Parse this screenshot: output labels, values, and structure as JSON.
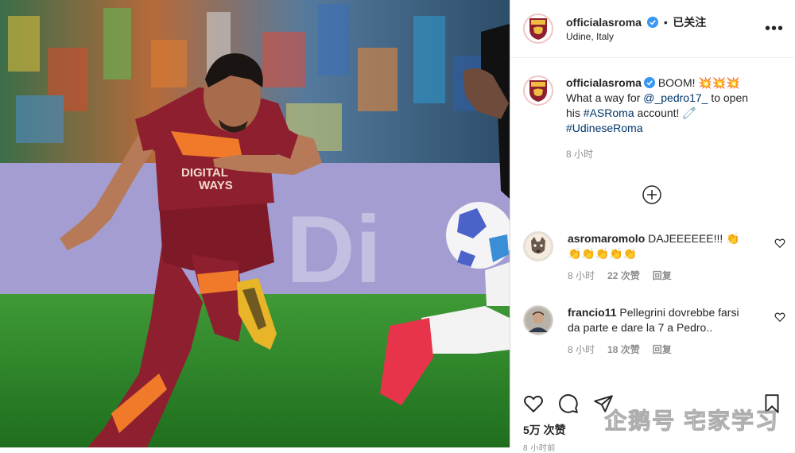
{
  "post": {
    "username": "officialasroma",
    "follow_label": "已关注",
    "location": "Udine, Italy",
    "more_label": "•••"
  },
  "photo": {
    "shirt_sponsor": "DIGITAL",
    "shirt_sponsor2": "WAYS",
    "board_text": "Di"
  },
  "caption": {
    "username": "officialasroma",
    "text_1": " BOOM! 💥💥💥",
    "text_2": "What a way for ",
    "mention": "@_pedro17_",
    "text_3": " to open his ",
    "hashtag1": "#ASRoma",
    "text_4": " account! 🧷",
    "hashtag2": "#UdineseRoma",
    "time": "8 小时"
  },
  "comments": [
    {
      "username": "asromaromolo",
      "text": " DAJEEEEEE!!! 👏",
      "text2": "👏👏👏👏👏",
      "time": "8 小时",
      "likes": "22 次赞",
      "reply": "回复"
    },
    {
      "username": "francio11",
      "text": " Pellegrini dovrebbe farsi da parte e dare la 7 a Pedro..",
      "time": "8 小时",
      "likes": "18 次赞",
      "reply": "回复"
    }
  ],
  "footer": {
    "likes": "5万 次赞",
    "time": "8 小时前"
  },
  "watermark": "企鹅号 宅家学习",
  "colors": {
    "roma_red": "#8e1f2f",
    "roma_gold": "#f0bc42",
    "verified_blue": "#3897f0",
    "link_blue": "#00376b",
    "grass": "#2e8a2a"
  }
}
